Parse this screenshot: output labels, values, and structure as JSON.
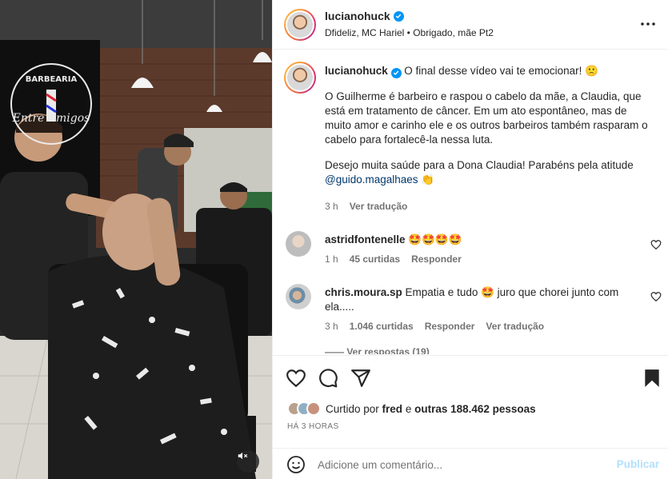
{
  "post": {
    "username": "lucianohuck",
    "audio": "Dfideliz, MC Hariel • Obrigado, mãe Pt2",
    "more_icon": "more-horizontal-icon",
    "media": {
      "sign_top": "BARBEARIA",
      "sign_main": "Entre Amigos",
      "mute_icon": "speaker-muted-icon"
    }
  },
  "caption": {
    "username": "lucianohuck",
    "line1": "O final desse vídeo vai te emocionar! 🙁",
    "para2": "O Guilherme é barbeiro e raspou o cabelo da mãe, a Claudia, que está em tratamento de câncer. Em um ato espontâneo, mas de muito amor e carinho ele e os outros barbeiros também rasparam o cabelo para fortalecê-la nessa luta.",
    "para3": "Desejo muita saúde para a Dona Claudia! Parabéns pela atitude ",
    "mention": "@guido.magalhaes",
    "mention_emoji": " 👏",
    "time": "3 h",
    "translate": "Ver tradução"
  },
  "comments": [
    {
      "username": "astridfontenelle",
      "text": " 🤩🤩🤩🤩",
      "time": "1 h",
      "likes": "45 curtidas",
      "reply": "Responder",
      "translate": ""
    },
    {
      "username": "chris.moura.sp",
      "text": " Empatia e tudo 🤩 juro que chorei junto com ela.....",
      "time": "3 h",
      "likes": "1.046 curtidas",
      "reply": "Responder",
      "translate": "Ver tradução"
    }
  ],
  "more_replies": "—— Ver respostas (19)",
  "likes": {
    "prefix": "Curtido por ",
    "user": "fred",
    "middle": " e ",
    "others": "outras 188.462 pessoas"
  },
  "posted_ago": "HÁ 3 HORAS",
  "add_comment": {
    "placeholder": "Adicione um comentário...",
    "post_label": "Publicar"
  },
  "colors": {
    "accent": "#0095f6",
    "publish_disabled": "#b2dffc",
    "muted_text": "#737373",
    "link": "#00376b"
  }
}
